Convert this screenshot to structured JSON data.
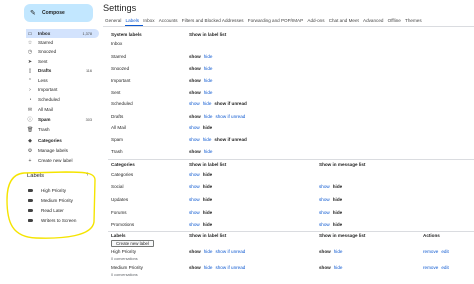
{
  "sidebar": {
    "compose_label": "Compose",
    "items": [
      {
        "icon": "inbox-icon",
        "label": "Inbox",
        "count": "1,378",
        "bold": true
      },
      {
        "icon": "star-icon",
        "label": "Starred",
        "count": ""
      },
      {
        "icon": "clock-icon",
        "label": "Snoozed",
        "count": ""
      },
      {
        "icon": "send-icon",
        "label": "Sent",
        "count": ""
      },
      {
        "icon": "draft-icon",
        "label": "Drafts",
        "count": "116",
        "bold": true
      },
      {
        "icon": "chevron-up-icon",
        "label": "Less",
        "count": ""
      },
      {
        "icon": "important-icon",
        "label": "Important",
        "count": ""
      },
      {
        "icon": "scheduled-icon",
        "label": "Scheduled",
        "count": ""
      },
      {
        "icon": "all-mail-icon",
        "label": "All Mail",
        "count": ""
      },
      {
        "icon": "spam-icon",
        "label": "Spam",
        "count": "303",
        "bold": true
      },
      {
        "icon": "trash-icon",
        "label": "Trash",
        "count": ""
      },
      {
        "icon": "categories-icon",
        "label": "Categories",
        "count": "",
        "bold": true
      },
      {
        "icon": "gear-icon",
        "label": "Manage labels",
        "count": ""
      },
      {
        "icon": "plus-icon",
        "label": "Create new label",
        "count": ""
      }
    ],
    "labels_heading": "Labels",
    "labels_add": "+",
    "user_labels": [
      "High Priority",
      "Medium Priority",
      "Read Later",
      "Writers to Screen"
    ]
  },
  "settings": {
    "title": "Settings",
    "tabs": [
      "General",
      "Labels",
      "Inbox",
      "Accounts",
      "Filters and Blocked Addresses",
      "Forwarding and POP/IMAP",
      "Add-ons",
      "Chat and Meet",
      "Advanced",
      "Offline",
      "Themes"
    ],
    "active_tab": "Labels",
    "system": {
      "header_name": "System labels",
      "header_list": "Show in label list",
      "rows": [
        {
          "name": "Inbox",
          "actions": []
        },
        {
          "name": "Starred",
          "actions": [
            {
              "t": "show",
              "b": true
            },
            {
              "t": "hide",
              "b": false
            }
          ]
        },
        {
          "name": "Snoozed",
          "actions": [
            {
              "t": "show",
              "b": true
            },
            {
              "t": "hide",
              "b": false
            }
          ]
        },
        {
          "name": "Important",
          "actions": [
            {
              "t": "show",
              "b": true
            },
            {
              "t": "hide",
              "b": false
            }
          ]
        },
        {
          "name": "Sent",
          "actions": [
            {
              "t": "show",
              "b": true
            },
            {
              "t": "hide",
              "b": false
            }
          ]
        },
        {
          "name": "Scheduled",
          "actions": [
            {
              "t": "show",
              "b": false
            },
            {
              "t": "hide",
              "b": false
            },
            {
              "t": "show if unread",
              "b": true
            }
          ]
        },
        {
          "name": "Drafts",
          "actions": [
            {
              "t": "show",
              "b": true
            },
            {
              "t": "hide",
              "b": false
            },
            {
              "t": "show if unread",
              "b": false
            }
          ]
        },
        {
          "name": "All Mail",
          "actions": [
            {
              "t": "show",
              "b": false
            },
            {
              "t": "hide",
              "b": true
            }
          ]
        },
        {
          "name": "Spam",
          "actions": [
            {
              "t": "show",
              "b": false
            },
            {
              "t": "hide",
              "b": false
            },
            {
              "t": "show if unread",
              "b": true
            }
          ]
        },
        {
          "name": "Trash",
          "actions": [
            {
              "t": "show",
              "b": true
            },
            {
              "t": "hide",
              "b": false
            }
          ]
        }
      ]
    },
    "categories": {
      "header_name": "Categories",
      "header_list": "Show in label list",
      "header_msg": "Show in message list",
      "rows": [
        {
          "name": "Categories",
          "list": [
            {
              "t": "show",
              "b": false
            },
            {
              "t": "hide",
              "b": true
            }
          ],
          "msg": []
        },
        {
          "name": "Social",
          "list": [
            {
              "t": "show",
              "b": false
            },
            {
              "t": "hide",
              "b": true
            }
          ],
          "msg": [
            {
              "t": "show",
              "b": false
            },
            {
              "t": "hide",
              "b": true
            }
          ]
        },
        {
          "name": "Updates",
          "list": [
            {
              "t": "show",
              "b": false
            },
            {
              "t": "hide",
              "b": true
            }
          ],
          "msg": [
            {
              "t": "show",
              "b": false
            },
            {
              "t": "hide",
              "b": true
            }
          ]
        },
        {
          "name": "Forums",
          "list": [
            {
              "t": "show",
              "b": false
            },
            {
              "t": "hide",
              "b": true
            }
          ],
          "msg": [
            {
              "t": "show",
              "b": false
            },
            {
              "t": "hide",
              "b": true
            }
          ]
        },
        {
          "name": "Promotions",
          "list": [
            {
              "t": "show",
              "b": false
            },
            {
              "t": "hide",
              "b": true
            }
          ],
          "msg": [
            {
              "t": "show",
              "b": false
            },
            {
              "t": "hide",
              "b": true
            }
          ]
        }
      ]
    },
    "labels": {
      "header_name": "Labels",
      "header_list": "Show in label list",
      "header_msg": "Show in message list",
      "header_actions": "Actions",
      "create_button": "Create new label",
      "rows": [
        {
          "name": "High Priority",
          "sub": "0 conversations",
          "list": [
            {
              "t": "show",
              "b": true
            },
            {
              "t": "hide",
              "b": false
            },
            {
              "t": "show if unread",
              "b": false
            }
          ],
          "msg": [
            {
              "t": "show",
              "b": true
            },
            {
              "t": "hide",
              "b": false
            }
          ],
          "actions": [
            "remove",
            "edit"
          ]
        },
        {
          "name": "Medium Priority",
          "sub": "0 conversations",
          "list": [
            {
              "t": "show",
              "b": true
            },
            {
              "t": "hide",
              "b": false
            },
            {
              "t": "show if unread",
              "b": false
            }
          ],
          "msg": [
            {
              "t": "show",
              "b": true
            },
            {
              "t": "hide",
              "b": false
            }
          ],
          "actions": [
            "remove",
            "edit"
          ]
        }
      ]
    }
  },
  "colors": {
    "accent": "#0b57d0",
    "compose_bg": "#c2e7ff",
    "highlight": "#f5e400"
  }
}
